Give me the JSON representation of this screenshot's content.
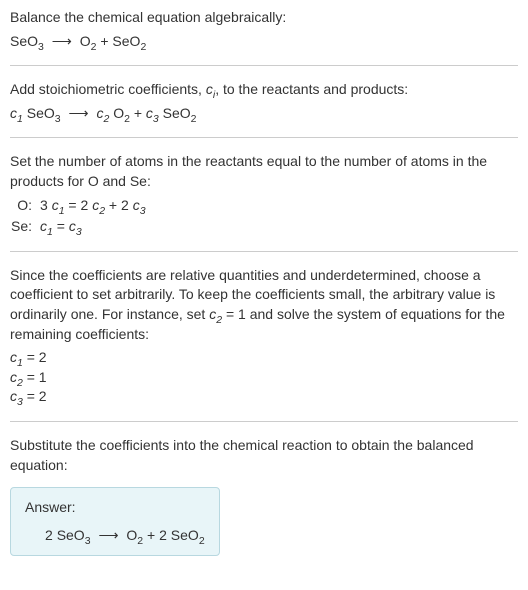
{
  "intro": {
    "line1": "Balance the chemical equation algebraically:",
    "reactant1": "SeO",
    "reactant1_sub": "3",
    "product1": "O",
    "product1_sub": "2",
    "product2": "SeO",
    "product2_sub": "2"
  },
  "step2": {
    "text_a": "Add stoichiometric coefficients, ",
    "ci": "c",
    "ci_sub": "i",
    "text_b": ", to the reactants and products:",
    "c1": "c",
    "c1_sub": "1",
    "r1": "SeO",
    "r1_sub": "3",
    "c2": "c",
    "c2_sub": "2",
    "p1": "O",
    "p1_sub": "2",
    "c3": "c",
    "c3_sub": "3",
    "p2": "SeO",
    "p2_sub": "2"
  },
  "step3": {
    "text": "Set the number of atoms in the reactants equal to the number of atoms in the products for O and Se:",
    "o_label": "O:",
    "o_lhs_coef": "3",
    "o_lhs_c": "c",
    "o_lhs_sub": "1",
    "o_eq": "=",
    "o_r1_coef": "2",
    "o_r1_c": "c",
    "o_r1_sub": "2",
    "o_plus": "+",
    "o_r2_coef": "2",
    "o_r2_c": "c",
    "o_r2_sub": "3",
    "se_label": "Se:",
    "se_lhs_c": "c",
    "se_lhs_sub": "1",
    "se_eq": "=",
    "se_rhs_c": "c",
    "se_rhs_sub": "3"
  },
  "step4": {
    "text_a": "Since the coefficients are relative quantities and underdetermined, choose a coefficient to set arbitrarily. To keep the coefficients small, the arbitrary value is ordinarily one. For instance, set ",
    "c2": "c",
    "c2_sub": "2",
    "text_b": " = 1 and solve the system of equations for the remaining coefficients:",
    "r1_c": "c",
    "r1_sub": "1",
    "r1_val": " = 2",
    "r2_c": "c",
    "r2_sub": "2",
    "r2_val": " = 1",
    "r3_c": "c",
    "r3_sub": "3",
    "r3_val": " = 2"
  },
  "step5": {
    "text": "Substitute the coefficients into the chemical reaction to obtain the balanced equation:"
  },
  "answer": {
    "title": "Answer:",
    "coef1": "2",
    "r1": "SeO",
    "r1_sub": "3",
    "p1": "O",
    "p1_sub": "2",
    "plus": "+",
    "coef2": "2",
    "p2": "SeO",
    "p2_sub": "2"
  },
  "arrow": "⟶"
}
